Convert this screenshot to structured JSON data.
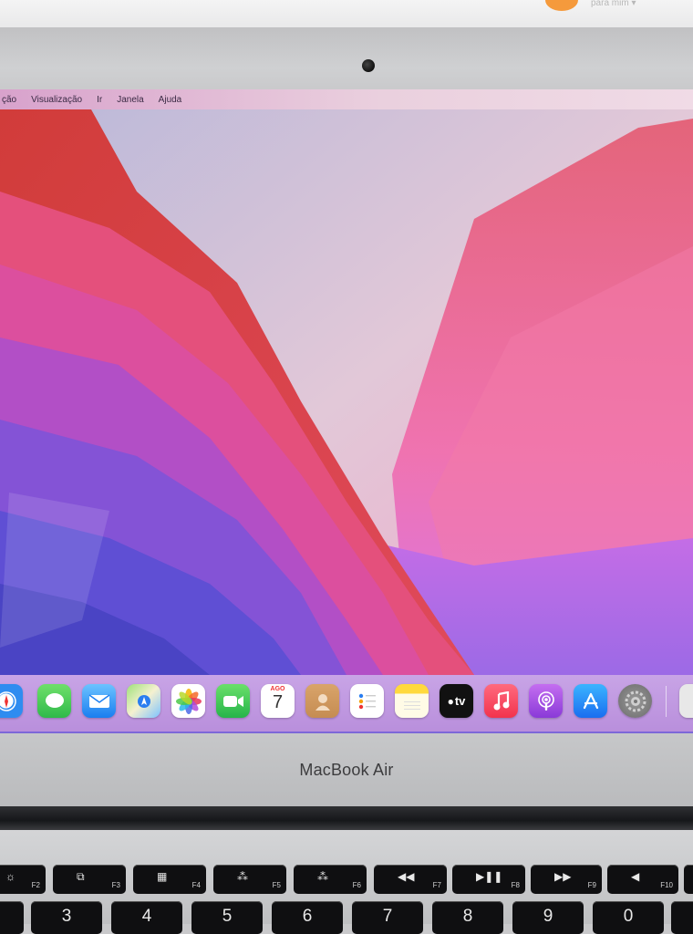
{
  "top_strip": {
    "text": "para mim ▾"
  },
  "menubar": {
    "items": [
      "ção",
      "Visualização",
      "Ir",
      "Janela",
      "Ajuda"
    ]
  },
  "dock": {
    "calendar": {
      "month": "AGO",
      "day": "7"
    },
    "appletv_label": "tv",
    "apps": [
      "safari-icon",
      "messages-icon",
      "mail-icon",
      "maps-icon",
      "photos-icon",
      "facetime-icon",
      "calendar-icon",
      "contacts-icon",
      "reminders-icon",
      "notes-icon",
      "appletv-icon",
      "music-icon",
      "podcasts-icon",
      "appstore-icon",
      "settings-icon"
    ]
  },
  "chin": {
    "label": "MacBook Air"
  },
  "keyboard": {
    "fkeys": [
      {
        "glyph": "☼",
        "label": "F2"
      },
      {
        "glyph": "⧉",
        "label": "F3"
      },
      {
        "glyph": "▦",
        "label": "F4"
      },
      {
        "glyph": "⁂",
        "label": "F5"
      },
      {
        "glyph": "⁂",
        "label": "F6"
      },
      {
        "glyph": "◀◀",
        "label": "F7"
      },
      {
        "glyph": "▶❚❚",
        "label": "F8"
      },
      {
        "glyph": "▶▶",
        "label": "F9"
      },
      {
        "glyph": "◀",
        "label": "F10"
      }
    ],
    "numbers": [
      "3",
      "4",
      "5",
      "6",
      "7",
      "8",
      "9",
      "0"
    ]
  },
  "colors": {
    "wallpaper_red": "#d8493e",
    "wallpaper_pink": "#e85a9a",
    "wallpaper_violet": "#8a5fe0",
    "wallpaper_blue": "#5b52d6",
    "dock_bg": "#c29ae2"
  }
}
